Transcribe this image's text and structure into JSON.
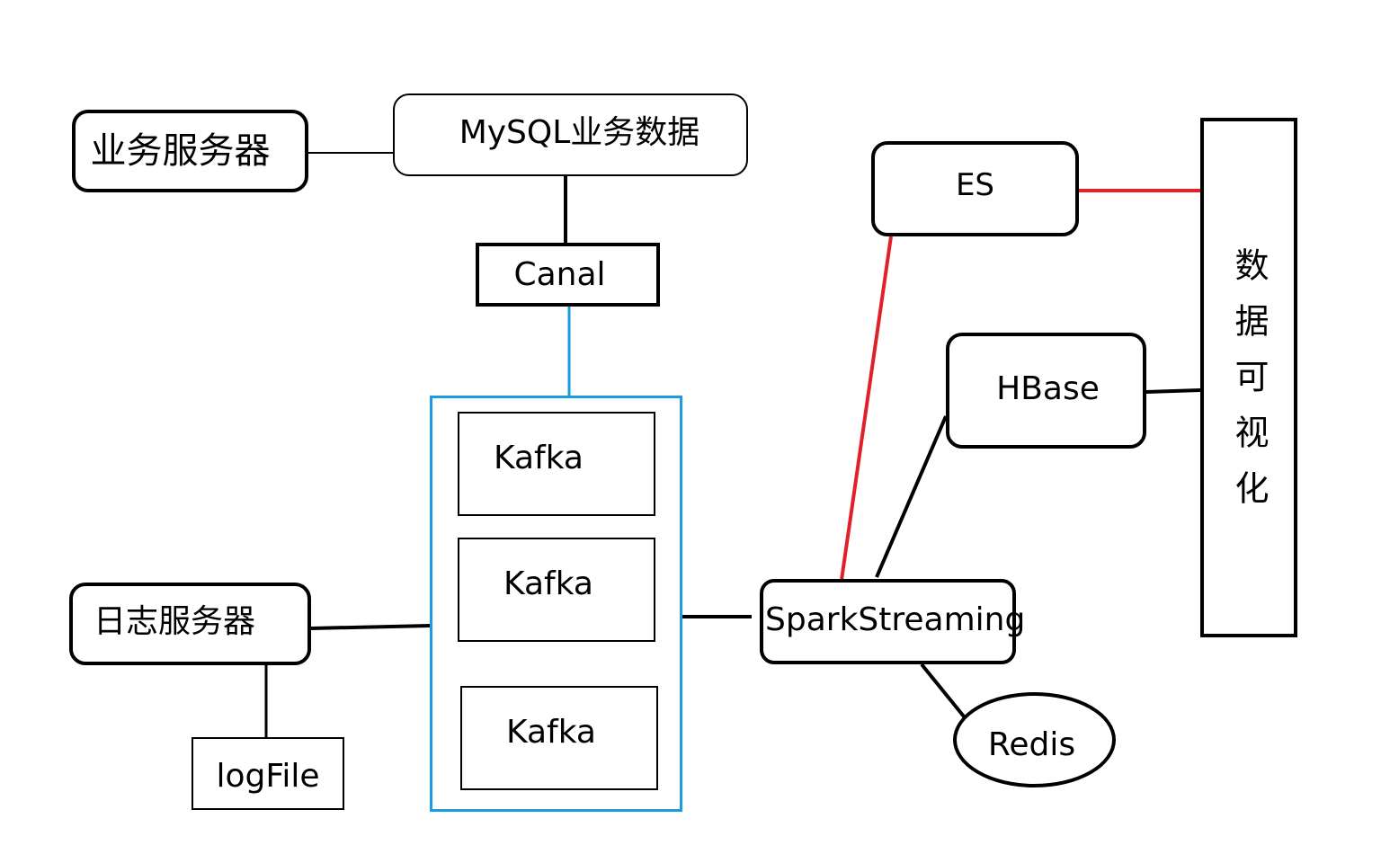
{
  "diagram": {
    "nodes": {
      "biz_server": "业务服务器",
      "mysql_data": "MySQL业务数据",
      "canal": "Canal",
      "kafka_1": "Kafka",
      "kafka_2": "Kafka",
      "kafka_3": "Kafka",
      "log_server": "日志服务器",
      "logfile": "logFile",
      "es": "ES",
      "hbase": "HBase",
      "spark_streaming": "SparkStreaming",
      "redis": "Redis",
      "visualization": "数据可视化"
    },
    "colors": {
      "default_line": "#000000",
      "kafka_cluster": "#1a9de0",
      "es_links": "#e0212b"
    }
  }
}
